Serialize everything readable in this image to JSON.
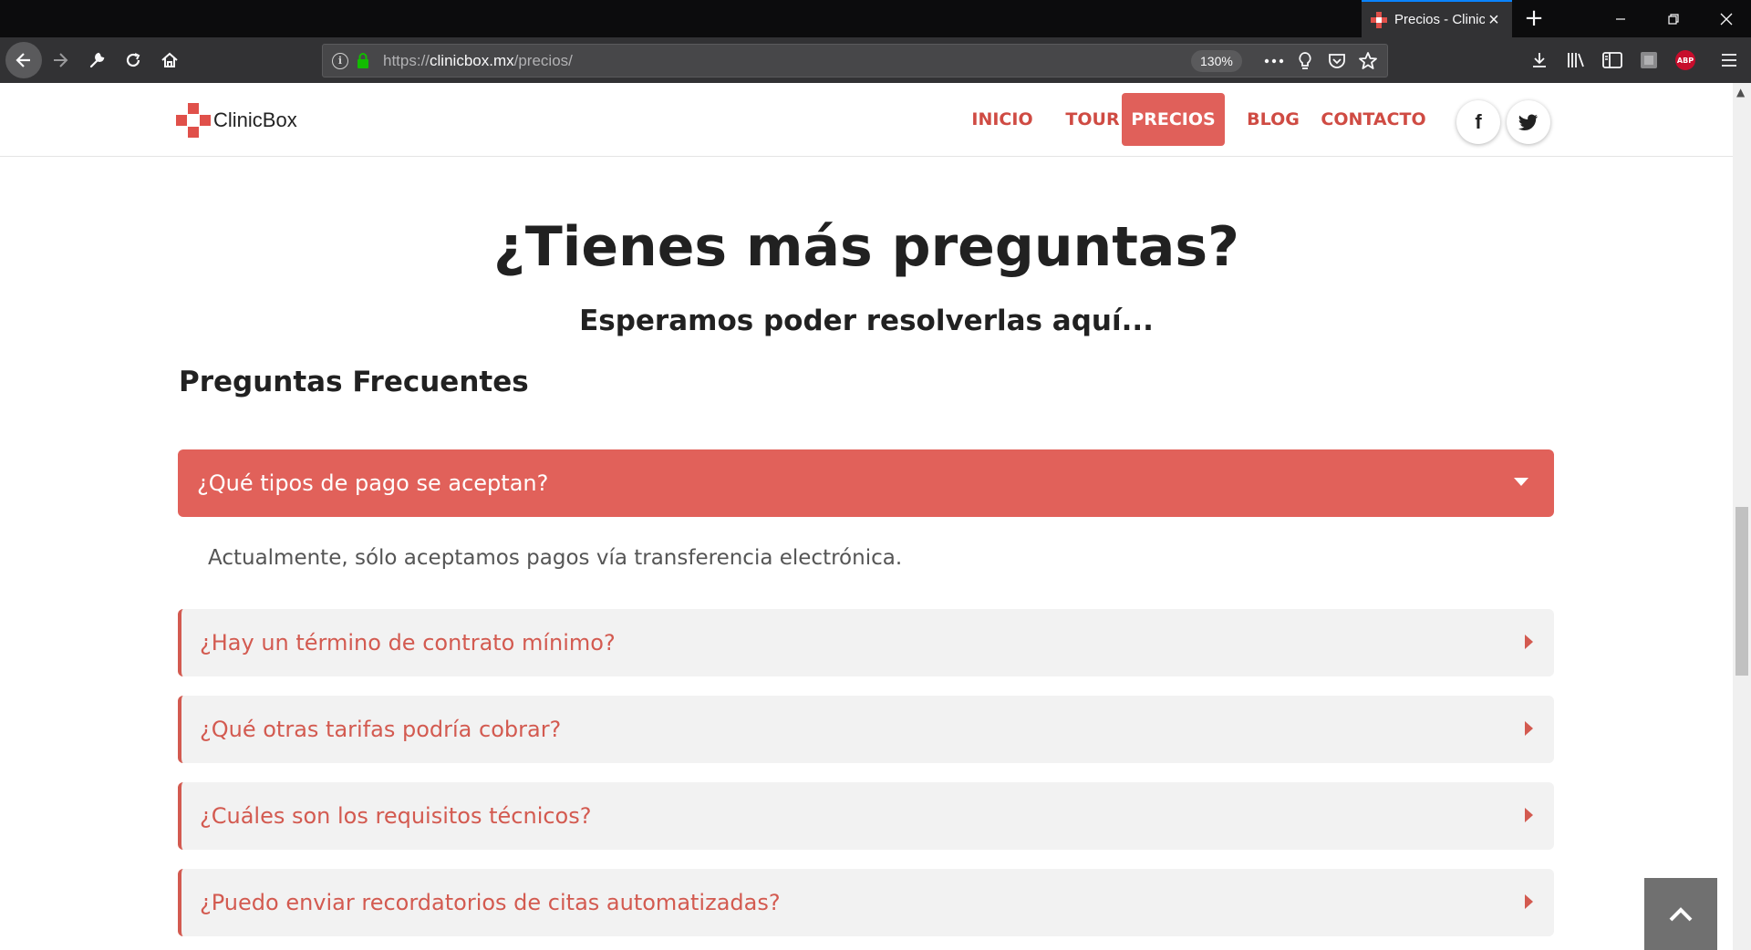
{
  "browser": {
    "tab_title": "Precios - ClinicBox",
    "url_prefix": "https://",
    "url_domain": "clinicbox.mx",
    "url_path": "/precios/",
    "zoom_level": "130%",
    "abp_label": "ABP"
  },
  "site": {
    "logo_text": "ClinicBox",
    "brand_color": "#e0504a",
    "nav": {
      "inicio": "INICIO",
      "tour": "TOUR",
      "precios": "PRECIOS",
      "blog": "BLOG",
      "contacto": "CONTACTO"
    },
    "social": {
      "facebook": "f",
      "twitter": "twitter-icon"
    }
  },
  "main": {
    "title": "¿Tienes más preguntas?",
    "subtitle": "Esperamos poder resolverlas aquí...",
    "faq_heading": "Preguntas Frecuentes",
    "faq": [
      {
        "question": "¿Qué tipos de pago se aceptan?",
        "answer": "Actualmente, sólo aceptamos pagos vía transferencia electrónica.",
        "expanded": true
      },
      {
        "question": "¿Hay un término de contrato mínimo?",
        "expanded": false
      },
      {
        "question": "¿Qué otras tarifas podría cobrar?",
        "expanded": false
      },
      {
        "question": "¿Cuáles son los requisitos técnicos?",
        "expanded": false
      },
      {
        "question": "¿Puedo enviar recordatorios de citas automatizadas?",
        "expanded": false
      }
    ]
  }
}
